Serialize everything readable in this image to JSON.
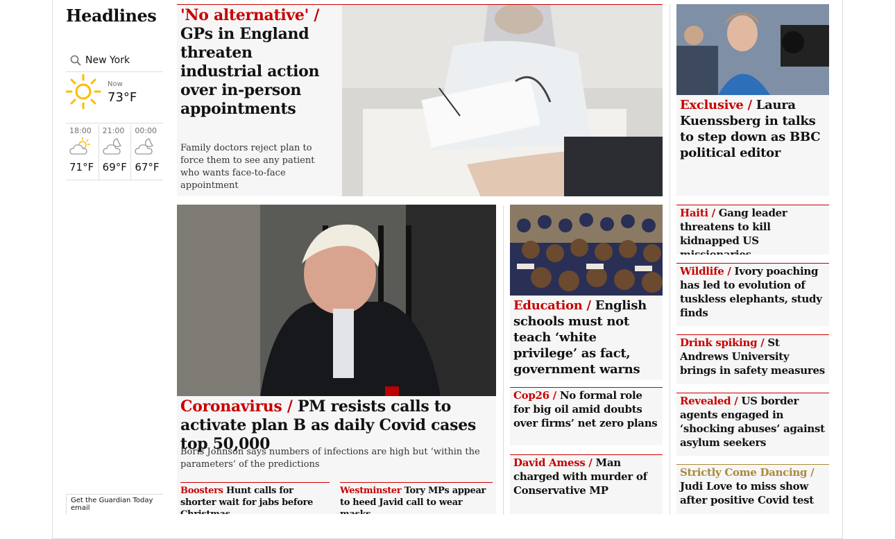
{
  "section": {
    "title": "Headlines"
  },
  "weather": {
    "location": "New York",
    "now_label": "Now",
    "now_temp": "73°F",
    "forecast": [
      {
        "time": "18:00",
        "temp": "71°F",
        "icon": "partly-cloudy-sun-icon"
      },
      {
        "time": "21:00",
        "temp": "69°F",
        "icon": "cloudy-night-icon"
      },
      {
        "time": "00:00",
        "temp": "67°F",
        "icon": "cloudy-night-icon"
      }
    ]
  },
  "email_signup": {
    "label": "Get the Guardian Today email"
  },
  "colors": {
    "news_red": "#c70000",
    "culture_gold": "#ab8938",
    "card_bg": "#f6f6f6",
    "sun_yellow": "#ffbb00"
  },
  "stories": {
    "top": {
      "kicker": "'No alternative' /",
      "headline": "GPs in England threaten industrial action over in-person appointments",
      "standfirst": "Family doctors reject plan to force them to see any patient who wants face-to-face appointment"
    },
    "right_top": {
      "kicker": "Exclusive /",
      "headline": "Laura Kuenssberg in talks to step down as BBC political editor"
    },
    "main": {
      "kicker": "Coronavirus /",
      "headline": "PM resists calls to activate plan B as daily Covid cases top 50,000",
      "standfirst": "Boris Johnson says numbers of infections are high but ‘within the parameters’ of the predictions",
      "sublinks": [
        {
          "kicker": "Boosters",
          "text": "Hunt calls for shorter wait for jabs before Christmas"
        },
        {
          "kicker": "Westminster",
          "text": "Tory MPs appear to heed Javid call to wear masks"
        }
      ]
    },
    "education": {
      "kicker": "Education /",
      "headline": "English schools must not teach ‘white privilege’ as fact, government warns"
    },
    "cop26": {
      "kicker": "Cop26 /",
      "headline": "No formal role for big oil amid doubts over firms’ net zero plans"
    },
    "amess": {
      "kicker": "David Amess /",
      "headline": "Man charged with murder of Conservative MP"
    },
    "haiti": {
      "kicker": "Haiti /",
      "headline": "Gang leader threatens to kill kidnapped US missionaries"
    },
    "wildlife": {
      "kicker": "Wildlife /",
      "headline": "Ivory poaching has led to evolution of tuskless elephants, study finds"
    },
    "spiking": {
      "kicker": "Drink spiking /",
      "headline": "St Andrews University brings in safety measures"
    },
    "revealed": {
      "kicker": "Revealed /",
      "headline": "US border agents engaged in ‘shocking abuses’ against asylum seekers"
    },
    "strictly": {
      "kicker": "Strictly Come Dancing  /",
      "headline": "Judi Love to miss show after positive Covid test"
    }
  }
}
